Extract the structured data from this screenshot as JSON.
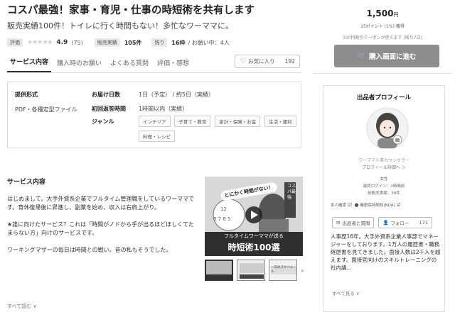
{
  "main": {
    "title": "コスパ最強！家事・育児・仕事の時短術を共有します",
    "subtitle": "販売実績100件！トイレに行く時間もない！多忙なワーママに。",
    "stats": {
      "rating_tag": "評価",
      "stars": "★★★★★",
      "rating": "4.9",
      "review_count": "(75)",
      "sales_tag": "販売実績",
      "sales_value": "105件",
      "remaining_tag": "残り",
      "remaining_value": "16枠",
      "inquiries": "/ お願い中：4人"
    },
    "tabs": [
      "サービス内容",
      "購入時のお願い",
      "よくある質問",
      "評価・感想"
    ],
    "favorite": {
      "label": "お気に入り",
      "count": "192"
    },
    "spec": {
      "format_label": "提供形式",
      "format_value": "PDF・各種定型ファイル",
      "delivery_label": "お届け日数",
      "delivery_value": "1日（予定） / 約5日（実績）",
      "response_label": "初回返答時間",
      "response_value": "1時間以内（実績）",
      "genre_label": "ジャンル",
      "genres": [
        "インテリア",
        "子育て・教育",
        "家計・保険・お金",
        "生活・便利",
        "料理・レシピ"
      ]
    },
    "service_title": "サービス内容",
    "description": [
      "はじめまして。大手外資系企業でフルタイム管理職をしているワーママです。育休復帰後に昇進し、副業を始め、収入は右肩上がり。",
      "★誰に向けたサービス？これは「時間がノドから手が出るほどほしくてたまらない方」向けのサービスです。",
      "ワーキングマザーの毎日は時間との戦い。昔の私もそうでした。"
    ],
    "read_more": "すべて読む ∨",
    "thumbnail": {
      "badge": "コスパ最強",
      "bubble": "とにかく時間がない！",
      "caption_line1": "フルタイムワーママが送る",
      "caption_line2": "時短術100選",
      "mini3": "一日のスケジュール"
    }
  },
  "sidebar": {
    "price": "1,500",
    "price_unit": "円",
    "points": "15ポイント (1%) 獲得",
    "coupon": "100円割引クーポンが使えます (残り7日)",
    "buy_label": "購入画面に進む",
    "profile": {
      "title": "出品者プロフィール",
      "seller_name": "ワーママ人事カウンセラー",
      "profile_link": "プロフィール詳細へ ＞",
      "gender": "女性",
      "last_login": "最終ログイン：2時間前",
      "response_rate": "総販売実績：30件",
      "identity": "本人確認",
      "nda": "機密保持契約(NDA)",
      "message_button": "出品者に質問",
      "follow_button": "フォロー",
      "follow_count": "171",
      "bio": "人事歴16年。大手外資系企業人事部でマネージャーをしております。1万人の履歴書・職務経歴書を見てきました。面接人数は2千人を超えます。面接官向けのスキルトレーニングの社内講...",
      "read_more": "すべて見る ∨"
    }
  },
  "colors": {
    "buy_button": "#8d8d8d",
    "border": "#dddddd",
    "accent_text": "#222222"
  }
}
